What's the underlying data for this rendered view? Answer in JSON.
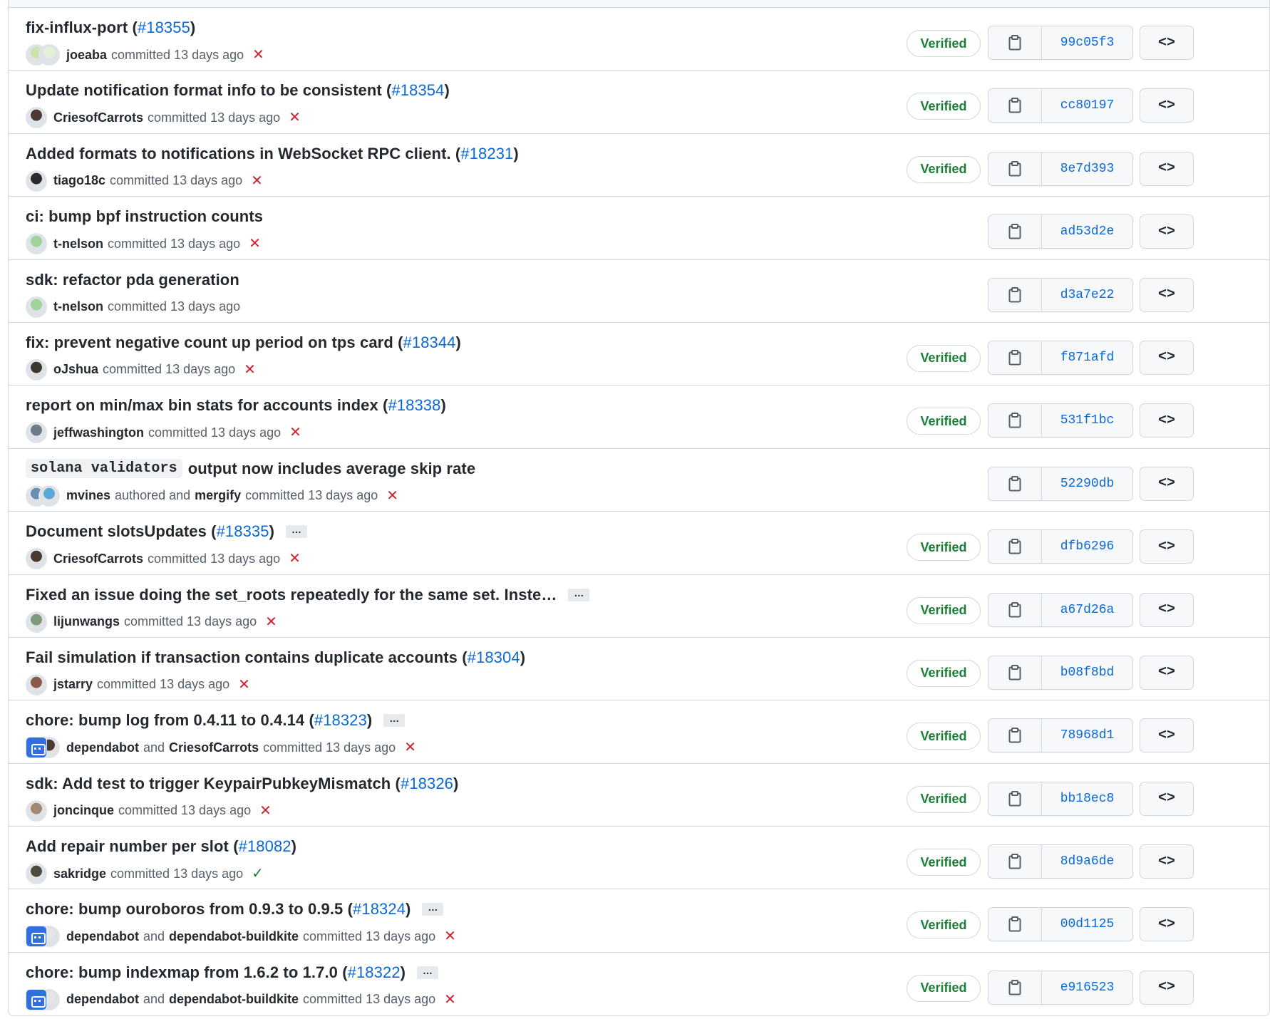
{
  "icons": {
    "copy": "clipboard-icon",
    "browse": "code-icon",
    "failed": "x-icon",
    "success": "check-icon",
    "more": "kebab-ellipsis-icon"
  },
  "colors": {
    "link": "#0969da",
    "verified": "#1a7f37",
    "fail": "#cf222e",
    "success": "#1a7f37",
    "border": "#d0d7de"
  },
  "labels": {
    "committed": "committed",
    "authored": "authored and",
    "and": "and",
    "verified": "Verified",
    "browse": "<>",
    "more": "…"
  },
  "commits": [
    {
      "title": "fix-influx-port (",
      "pr": "#18355",
      "close": ")",
      "authors": [
        "joeaba"
      ],
      "co_type": "",
      "time": "committed 13 days ago",
      "status": "fail",
      "verified": true,
      "sha": "99c05f3",
      "avatars": [
        "#c9e4a8",
        "#e5f1d6"
      ],
      "more": false
    },
    {
      "title": "Update notification format info to be consistent (",
      "pr": "#18354",
      "close": ")",
      "authors": [
        "CriesofCarrots"
      ],
      "co_type": "",
      "time": "committed 13 days ago",
      "status": "fail",
      "verified": true,
      "sha": "cc80197",
      "avatars": [
        "#4b3a32"
      ],
      "more": false
    },
    {
      "title": "Added formats to notifications in WebSocket RPC client. (",
      "pr": "#18231",
      "close": ")",
      "authors": [
        "tiago18c"
      ],
      "co_type": "",
      "time": "committed 13 days ago",
      "status": "fail",
      "verified": true,
      "sha": "8e7d393",
      "avatars": [
        "#2a2a2a"
      ],
      "more": false
    },
    {
      "title": "ci: bump bpf instruction counts",
      "pr": "",
      "close": "",
      "authors": [
        "t-nelson"
      ],
      "co_type": "",
      "time": "committed 13 days ago",
      "status": "fail",
      "verified": false,
      "sha": "ad53d2e",
      "avatars": [
        "#9fd39a"
      ],
      "more": false
    },
    {
      "title": "sdk: refactor pda generation",
      "pr": "",
      "close": "",
      "authors": [
        "t-nelson"
      ],
      "co_type": "",
      "time": "committed 13 days ago",
      "status": "none",
      "verified": false,
      "sha": "d3a7e22",
      "avatars": [
        "#9fd39a"
      ],
      "more": false
    },
    {
      "title": "fix: prevent negative count up period on tps card (",
      "pr": "#18344",
      "close": ")",
      "authors": [
        "oJshua"
      ],
      "co_type": "",
      "time": "committed 13 days ago",
      "status": "fail",
      "verified": true,
      "sha": "f871afd",
      "avatars": [
        "#3c3a2e"
      ],
      "more": false
    },
    {
      "title": "report on min/max bin stats for accounts index (",
      "pr": "#18338",
      "close": ")",
      "authors": [
        "jeffwashington"
      ],
      "co_type": "",
      "time": "committed 13 days ago",
      "status": "fail",
      "verified": true,
      "sha": "531f1bc",
      "avatars": [
        "#6f7b86"
      ],
      "more": false
    },
    {
      "title": "output now includes average skip rate",
      "code": "solana validators",
      "pr": "",
      "close": "",
      "authors": [
        "mvines",
        "mergify"
      ],
      "co_type": "authored",
      "time": "committed 13 days ago",
      "status": "fail",
      "verified": false,
      "sha": "52290db",
      "avatars": [
        "#6b8fb0",
        "#5aa8d8"
      ],
      "more": false
    },
    {
      "title": "Document slotsUpdates (",
      "pr": "#18335",
      "close": ")",
      "authors": [
        "CriesofCarrots"
      ],
      "co_type": "",
      "time": "committed 13 days ago",
      "status": "fail",
      "verified": true,
      "sha": "dfb6296",
      "avatars": [
        "#4b3a32"
      ],
      "more": true
    },
    {
      "title": "Fixed an issue doing the set_roots repeatedly for the same set. Inste…",
      "pr": "",
      "close": "",
      "authors": [
        "lijunwangs"
      ],
      "co_type": "",
      "time": "committed 13 days ago",
      "status": "fail",
      "verified": true,
      "sha": "a67d26a",
      "avatars": [
        "#7d9a7a"
      ],
      "more": true
    },
    {
      "title": "Fail simulation if transaction contains duplicate accounts (",
      "pr": "#18304",
      "close": ")",
      "authors": [
        "jstarry"
      ],
      "co_type": "",
      "time": "committed 13 days ago",
      "status": "fail",
      "verified": true,
      "sha": "b08f8bd",
      "avatars": [
        "#8a5a4a"
      ],
      "more": false
    },
    {
      "title": "chore: bump log from 0.4.11 to 0.4.14 (",
      "pr": "#18323",
      "close": ")",
      "authors": [
        "dependabot",
        "CriesofCarrots"
      ],
      "co_type": "and",
      "time": "committed 13 days ago",
      "status": "fail",
      "verified": true,
      "sha": "78968d1",
      "avatars": [
        "bot",
        "#4b3a32"
      ],
      "more": true
    },
    {
      "title": "sdk: Add test to trigger KeypairPubkeyMismatch (",
      "pr": "#18326",
      "close": ")",
      "authors": [
        "joncinque"
      ],
      "co_type": "",
      "time": "committed 13 days ago",
      "status": "fail",
      "verified": true,
      "sha": "bb18ec8",
      "avatars": [
        "#a08872"
      ],
      "more": false
    },
    {
      "title": "Add repair number per slot (",
      "pr": "#18082",
      "close": ")",
      "authors": [
        "sakridge"
      ],
      "co_type": "",
      "time": "committed 13 days ago",
      "status": "ok",
      "verified": true,
      "sha": "8d9a6de",
      "avatars": [
        "#4d4a3e"
      ],
      "more": false
    },
    {
      "title": "chore: bump ouroboros from 0.9.3 to 0.9.5 (",
      "pr": "#18324",
      "close": ")",
      "authors": [
        "dependabot",
        "dependabot-buildkite"
      ],
      "co_type": "and",
      "time": "committed 13 days ago",
      "status": "fail",
      "verified": true,
      "sha": "00d1125",
      "avatars": [
        "bot",
        "#e6e6e6"
      ],
      "more": true
    },
    {
      "title": "chore: bump indexmap from 1.6.2 to 1.7.0 (",
      "pr": "#18322",
      "close": ")",
      "authors": [
        "dependabot",
        "dependabot-buildkite"
      ],
      "co_type": "and",
      "time": "committed 13 days ago",
      "status": "fail",
      "verified": true,
      "sha": "e916523",
      "avatars": [
        "bot",
        "#e6e6e6"
      ],
      "more": true
    }
  ]
}
